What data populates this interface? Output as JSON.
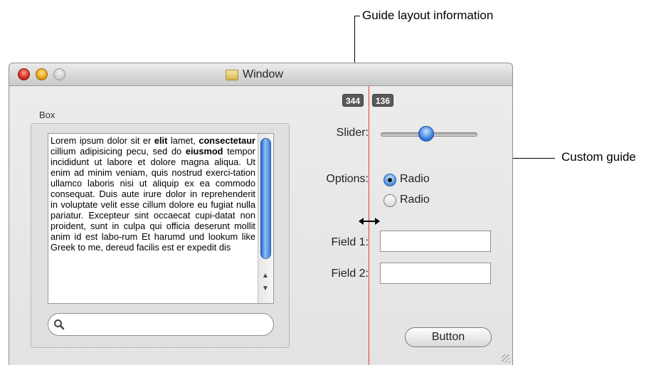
{
  "annotations": {
    "guide_layout_label": "Guide layout information",
    "custom_guide_label": "Custom guide"
  },
  "window": {
    "title": "Window",
    "guide_badges": [
      "344",
      "136"
    ]
  },
  "box": {
    "title": "Box",
    "text_html": "Lorem ipsum dolor sit er <b>elit</b> lamet, <b>consectetaur</b> cillium adipisicing pecu, sed do <b>eiusmod</b> tempor incididunt ut labore et dolore magna aliqua. Ut enim ad minim veniam, quis nostrud exerci-tation ullamco laboris nisi ut aliquip ex ea commodo consequat. Duis aute irure dolor in reprehenderit in voluptate velit esse cillum dolore eu fugiat nulla pariatur. Excepteur sint occaecat cupi-datat non proident, sunt in culpa qui officia deserunt mollit anim id est labo-rum Et harumd und lookum like Greek to me, dereud facilis est er expedit dis",
    "search_placeholder": ""
  },
  "controls": {
    "slider_label": "Slider:",
    "options_label": "Options:",
    "radio1_label": "Radio",
    "radio2_label": "Radio",
    "field1_label": "Field 1:",
    "field2_label": "Field 2:",
    "button_label": "Button",
    "slider_value": 0.45
  },
  "colors": {
    "guide_line": "#e23b3b",
    "accent": "#3c7fe0"
  }
}
